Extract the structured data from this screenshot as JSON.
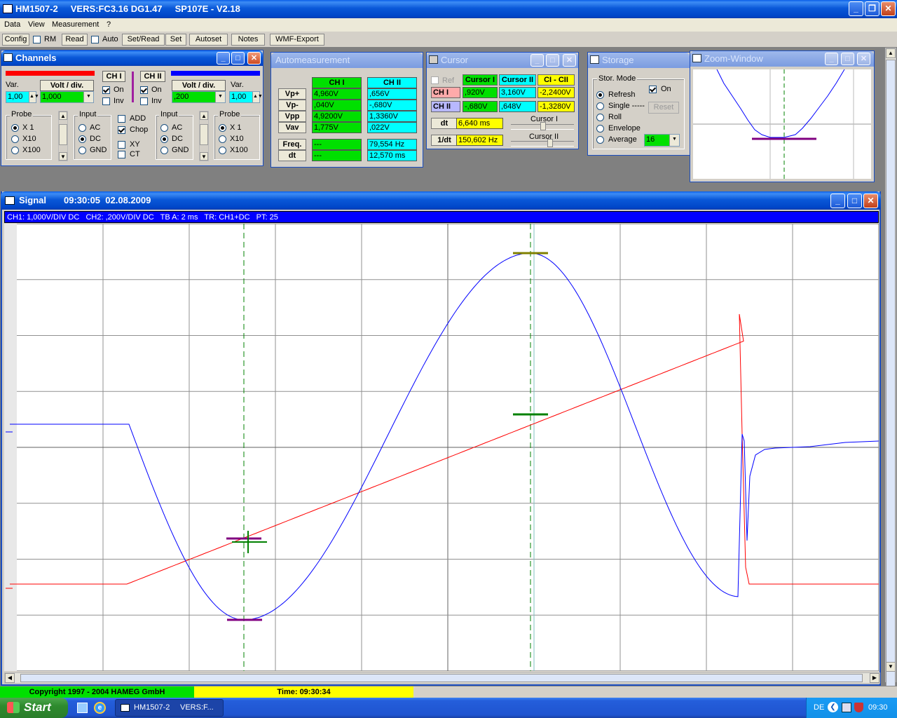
{
  "window": {
    "title": "HM1507-2     VERS:FC3.16 DG1.47     SP107E - V2.18"
  },
  "menu": [
    "Data",
    "View",
    "Measurement",
    "?"
  ],
  "toolbar": {
    "config": "Config",
    "rm": "RM",
    "read": "Read",
    "auto": "Auto",
    "set_read": "Set/Read",
    "set": "Set",
    "autoset": "Autoset",
    "notes": "Notes",
    "wmf_export": "WMF-Export"
  },
  "channels": {
    "title": "Channels",
    "var_label": "Var.",
    "volt_div_label": "Volt / div.",
    "ch1": {
      "label": "CH I",
      "var": "1,00",
      "volt_div": "1,000",
      "on": "On",
      "inv": "Inv",
      "color": "#ff0000"
    },
    "ch2": {
      "label": "CH II",
      "var": "1,00",
      "volt_div": ",200",
      "on": "On",
      "inv": "Inv",
      "color": "#0000ff"
    },
    "probe_label": "Probe",
    "probe_opts": [
      "X 1",
      "X10",
      "X100"
    ],
    "input_label": "Input",
    "input_opts": [
      "AC",
      "DC",
      "GND"
    ],
    "mode_opts": [
      "ADD",
      "Chop",
      "XY",
      "CT"
    ]
  },
  "automeasure": {
    "title": "Automeasurement",
    "col1": "CH I",
    "col2": "CH II",
    "rows": [
      {
        "label": "Vp+",
        "ch1": "4,960V",
        "ch2": ",656V"
      },
      {
        "label": "Vp-",
        "ch1": ",040V",
        "ch2": "-,680V"
      },
      {
        "label": "Vpp",
        "ch1": "4,9200V",
        "ch2": "1,3360V"
      },
      {
        "label": "Vav",
        "ch1": "1,775V",
        "ch2": ",022V"
      }
    ],
    "freq": {
      "label": "Freq.",
      "ch1": "---",
      "ch2": "79,554 Hz"
    },
    "dt": {
      "label": "dt",
      "ch1": "---",
      "ch2": "12,570 ms"
    }
  },
  "cursor": {
    "title": "Cursor",
    "ref": "Ref",
    "col1": "Cursor I",
    "col2": "Cursor II",
    "col3": "CI - CII",
    "ch1": {
      "label": "CH I",
      "c1": ",920V",
      "c2": "3,160V",
      "diff": "-2,2400V"
    },
    "ch2": {
      "label": "CH II",
      "c1": "-,680V",
      "c2": ",648V",
      "diff": "-1,3280V"
    },
    "dt_label": "dt",
    "dt": "6,640 ms",
    "inv_label": "1/dt",
    "inv": "150,602 Hz",
    "slider1": "Cursor I",
    "slider2": "Cursor II"
  },
  "storage": {
    "title": "Storage",
    "mode_label": "Stor. Mode",
    "modes": [
      "Refresh",
      "Single -----",
      "Roll",
      "Envelope",
      "Average"
    ],
    "on": "On",
    "reset": "Reset",
    "average": "16"
  },
  "zoom": {
    "title": "Zoom-Window"
  },
  "signal": {
    "title": "Signal",
    "time": "09:30:05  02.08.2009",
    "info": "CH1: 1,000V/DIV DC   CH2: ,200V/DIV DC   TB A: 2 ms   TR: CH1+DC   PT: 25"
  },
  "status": {
    "copyright": "Copyright 1997 - 2004 HAMEG GmbH",
    "time": "Time: 09:30:34"
  },
  "taskbar": {
    "start": "Start",
    "task1": "HM1507-2",
    "task2": "VERS:F...",
    "lang": "DE",
    "clock": "09:30"
  },
  "colors": {
    "ch1": "#ff0000",
    "ch2": "#0000ff",
    "grid": "#808080",
    "cursor": "#008000"
  }
}
